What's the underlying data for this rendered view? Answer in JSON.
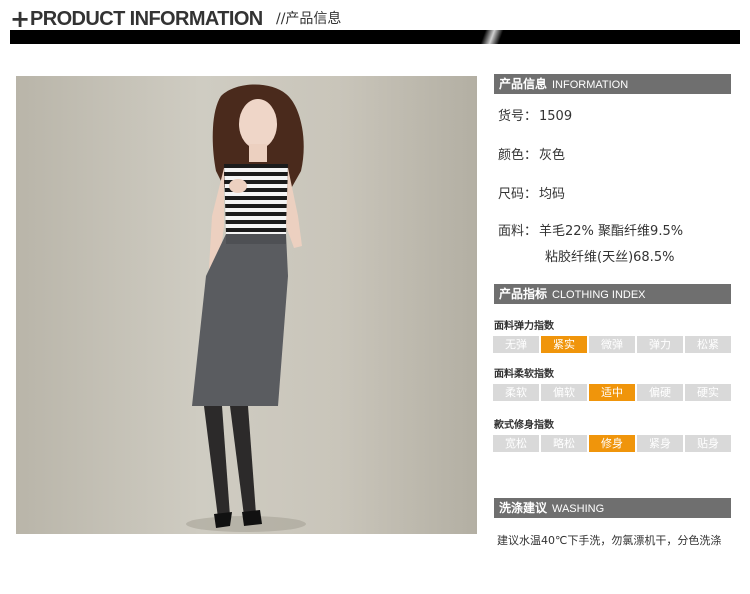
{
  "header": {
    "plus": "+",
    "title_en": "PRODUCT INFORMATION",
    "title_cn": "//产品信息"
  },
  "info_section": {
    "cn": "产品信息",
    "en": "INFORMATION"
  },
  "info": {
    "sku_label": "货号：",
    "sku_value": "1509",
    "color_label": "颜色：",
    "color_value": "灰色",
    "size_label": "尺码：",
    "size_value": "均码",
    "fabric_label": "面料：",
    "fabric_line1": "羊毛22% 聚酯纤维9.5%",
    "fabric_line2": "粘胶纤维(天丝)68.5%"
  },
  "index_section": {
    "cn": "产品指标",
    "en": "CLOTHING INDEX"
  },
  "indices": [
    {
      "title": "面料弹力指数",
      "options": [
        "无弹",
        "紧实",
        "微弹",
        "弹力",
        "松紧"
      ],
      "selected": "紧实"
    },
    {
      "title": "面料柔软指数",
      "options": [
        "柔软",
        "偏软",
        "适中",
        "偏硬",
        "硬实"
      ],
      "selected": "适中"
    },
    {
      "title": "款式修身指数",
      "options": [
        "宽松",
        "略松",
        "修身",
        "紧身",
        "贴身"
      ],
      "selected": "修身"
    }
  ],
  "wash_section": {
    "cn": "洗涤建议",
    "en": "WASHING"
  },
  "wash_text": "建议水温40℃下手洗，勿氯漂机干，分色洗涤",
  "colors": {
    "accent": "#f0950b",
    "inactive": "#d9d9d9",
    "section_bar": "#6f6f6f"
  }
}
